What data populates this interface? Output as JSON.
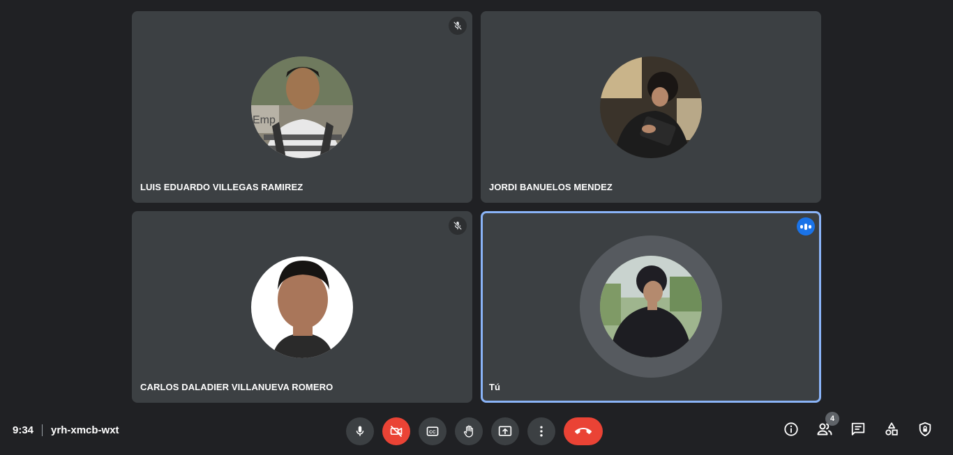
{
  "participants": [
    {
      "name": "LUIS EDUARDO VILLEGAS RAMIREZ",
      "muted": true
    },
    {
      "name": "JORDI BANUELOS MENDEZ",
      "muted": false
    },
    {
      "name": "CARLOS DALADIER VILLANUEVA ROMERO",
      "muted": true
    },
    {
      "name": "Tú",
      "speaking": true
    }
  ],
  "meeting": {
    "time": "9:34",
    "code": "yrh-xmcb-wxt"
  },
  "controls": {
    "mic": "microphone-icon",
    "camera": "camera-off-icon",
    "captions": "captions-icon",
    "hand": "raise-hand-icon",
    "present": "present-screen-icon",
    "more": "more-options-icon",
    "end": "end-call-icon"
  },
  "right_controls": {
    "people_count": "4"
  },
  "colors": {
    "accent": "#8ab4f8",
    "end_call": "#ea4335",
    "tile": "#3c4043",
    "background": "#202124"
  }
}
